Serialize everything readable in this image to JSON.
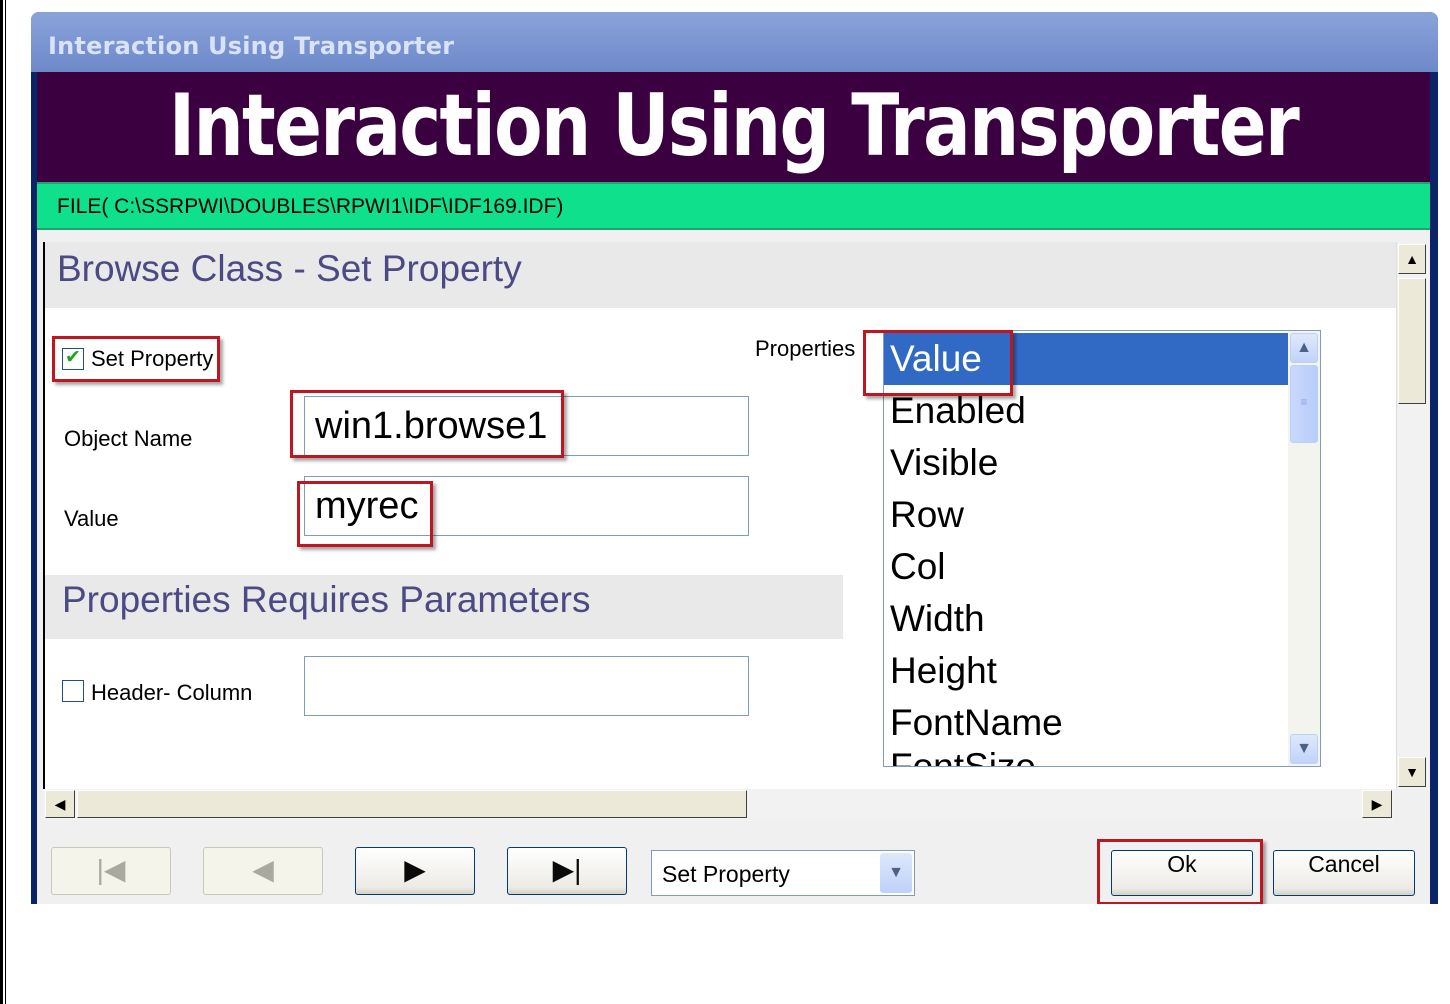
{
  "window": {
    "title": "Interaction Using Transporter"
  },
  "banner": {
    "title": "Interaction Using Transporter"
  },
  "file_path": "FILE( C:\\SSRPWI\\DOUBLES\\RPWI1\\IDF\\IDF169.IDF)",
  "panel": {
    "header": "Browse Class - Set Property",
    "set_property_label": "Set Property",
    "set_property_checked": true,
    "object_name_label": "Object Name",
    "object_name_value": "win1.browse1",
    "value_label": "Value",
    "value_value": "myrec",
    "section2_header": "Properties Requires Parameters",
    "header_column_label": "Header- Column",
    "header_column_checked": false,
    "header_column_value": "",
    "properties_label": "Properties",
    "properties": [
      "Value",
      "Enabled",
      "Visible",
      "Row",
      "Col",
      "Width",
      "Height",
      "FontName",
      "FontSize"
    ],
    "selected_property": "Value"
  },
  "toolbar": {
    "mode_value": "Set Property",
    "ok_label": "Ok",
    "cancel_label": "Cancel"
  },
  "icons": {
    "first": "first-record-icon",
    "prev": "previous-record-icon",
    "next": "next-record-icon",
    "last": "last-record-icon"
  },
  "colors": {
    "banner": "#3b003f",
    "file_bar": "#0ee08c",
    "selection": "#316ac5",
    "highlight_box": "#c0161f",
    "header_text": "#4b4a85"
  }
}
